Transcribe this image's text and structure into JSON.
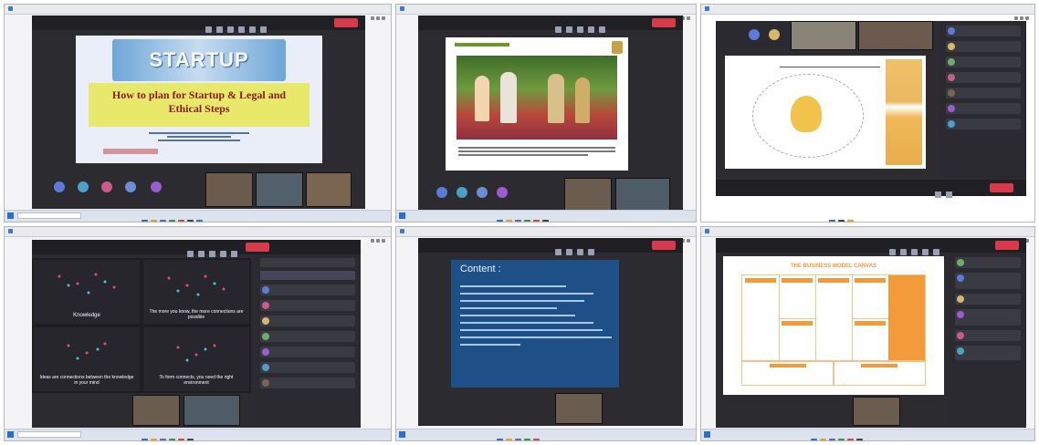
{
  "panels": [
    {
      "name": "panel-startup-slide",
      "slide": {
        "banner_title": "STARTUP",
        "heading": "How to plan for Startup & Legal and Ethical Steps"
      }
    },
    {
      "name": "panel-event-photo",
      "slide": {}
    },
    {
      "name": "panel-idea-slide",
      "slide": {}
    },
    {
      "name": "panel-knowledge-slide",
      "slide": {
        "q1": "Knowledge",
        "q2": "The more you know, the more connections are possible",
        "q3": "Ideas are connections between the knowledge in your mind",
        "q4": "To form connects, you need the right environment"
      }
    },
    {
      "name": "panel-content-slide",
      "slide": {
        "title": "Content :"
      }
    },
    {
      "name": "panel-business-canvas",
      "slide": {
        "title": "THE BUSINESS MODEL CANVAS"
      }
    }
  ],
  "colors": {
    "meeting_bg": "#2b2b30",
    "leave_red": "#d73a4a",
    "slide_yellow": "#e8e86a",
    "canvas_orange": "#f39a3a",
    "content_blue": "#1f4f87"
  }
}
